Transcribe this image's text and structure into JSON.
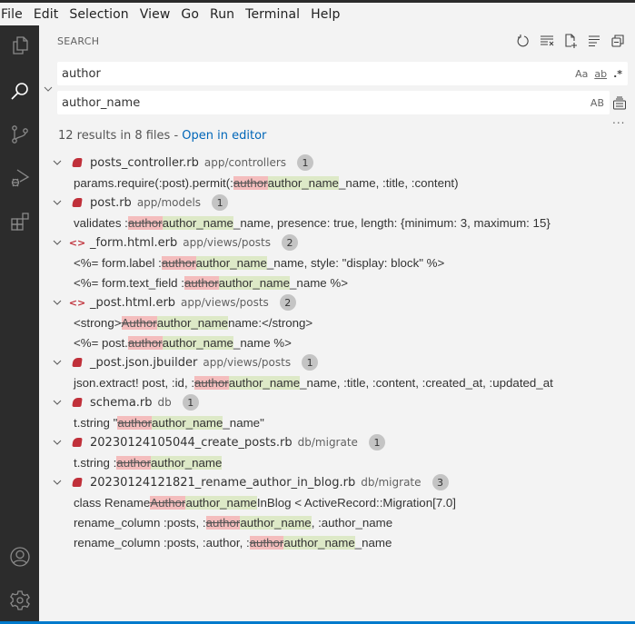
{
  "menu": [
    "File",
    "Edit",
    "Selection",
    "View",
    "Go",
    "Run",
    "Terminal",
    "Help"
  ],
  "activity_bar": {
    "top": [
      "explorer-icon",
      "search-icon",
      "source-control-icon",
      "run-debug-icon",
      "extensions-icon"
    ],
    "bottom": [
      "accounts-icon",
      "manage-gear-icon"
    ],
    "active": "search-icon"
  },
  "sidebar": {
    "title": "SEARCH",
    "actions": [
      "refresh-icon",
      "clear-results-icon",
      "new-search-editor-icon",
      "view-as-tree-icon",
      "collapse-all-icon"
    ],
    "search": {
      "value": "author",
      "options": [
        "Aa",
        "ab",
        ".*"
      ]
    },
    "replace": {
      "value": "author_name",
      "options": [
        "AB"
      ]
    },
    "more": "...",
    "summary": {
      "text": "12 results in 8 files - ",
      "link": "Open in editor"
    }
  },
  "results": [
    {
      "file": "posts_controller.rb",
      "path": "app/controllers",
      "icon": "ruby",
      "count": "1",
      "matches": [
        {
          "pre": "params.require(:post).permit(:",
          "del": "author",
          "ins": "author_name",
          "post": "_name, :title, :content)"
        }
      ]
    },
    {
      "file": "post.rb",
      "path": "app/models",
      "icon": "ruby",
      "count": "1",
      "matches": [
        {
          "pre": "validates :",
          "del": "author",
          "ins": "author_name",
          "post": "_name, presence: true, length: {minimum: 3, maximum: 15}"
        }
      ]
    },
    {
      "file": "_form.html.erb",
      "path": "app/views/posts",
      "icon": "erb",
      "count": "2",
      "matches": [
        {
          "pre": "<%= form.label :",
          "del": "author",
          "ins": "author_name",
          "post": "_name, style: \"display: block\" %>"
        },
        {
          "pre": "<%= form.text_field :",
          "del": "author",
          "ins": "author_name",
          "post": "_name %>"
        }
      ]
    },
    {
      "file": "_post.html.erb",
      "path": "app/views/posts",
      "icon": "erb",
      "count": "2",
      "matches": [
        {
          "pre": "<strong>",
          "del": "Author",
          "ins": "author_name",
          "post": " name:</strong>"
        },
        {
          "pre": "<%= post.",
          "del": "author",
          "ins": "author_name",
          "post": "_name %>"
        }
      ]
    },
    {
      "file": "_post.json.jbuilder",
      "path": "app/views/posts",
      "icon": "ruby",
      "count": "1",
      "matches": [
        {
          "pre": "json.extract! post, :id, :",
          "del": "author",
          "ins": "author_name",
          "post": "_name, :title, :content, :created_at, :updated_at"
        }
      ]
    },
    {
      "file": "schema.rb",
      "path": "db",
      "icon": "ruby",
      "count": "1",
      "matches": [
        {
          "pre": "t.string \"",
          "del": "author",
          "ins": "author_name",
          "post": "_name\""
        }
      ]
    },
    {
      "file": "20230124105044_create_posts.rb",
      "path": "db/migrate",
      "icon": "ruby",
      "count": "1",
      "matches": [
        {
          "pre": "t.string :",
          "del": "author",
          "ins": "author_name",
          "post": ""
        }
      ]
    },
    {
      "file": "20230124121821_rename_author_in_blog.rb",
      "path": "db/migrate",
      "icon": "ruby",
      "count": "3",
      "matches": [
        {
          "pre": "class Rename",
          "del": "Author",
          "ins": "author_name",
          "post": "InBlog < ActiveRecord::Migration[7.0]"
        },
        {
          "pre": "rename_column :posts, :",
          "del": "author",
          "ins": "author_name",
          "post": ", :author_name"
        },
        {
          "pre": "rename_column :posts, :author, :",
          "del": "author",
          "ins": "author_name",
          "post": "_name"
        }
      ]
    }
  ],
  "colors": {
    "accent": "#007acc",
    "link": "#0066b8",
    "ruby": "#c0303a",
    "deleted_bg": "#f4bdbd",
    "inserted_bg": "#dde9c7"
  }
}
